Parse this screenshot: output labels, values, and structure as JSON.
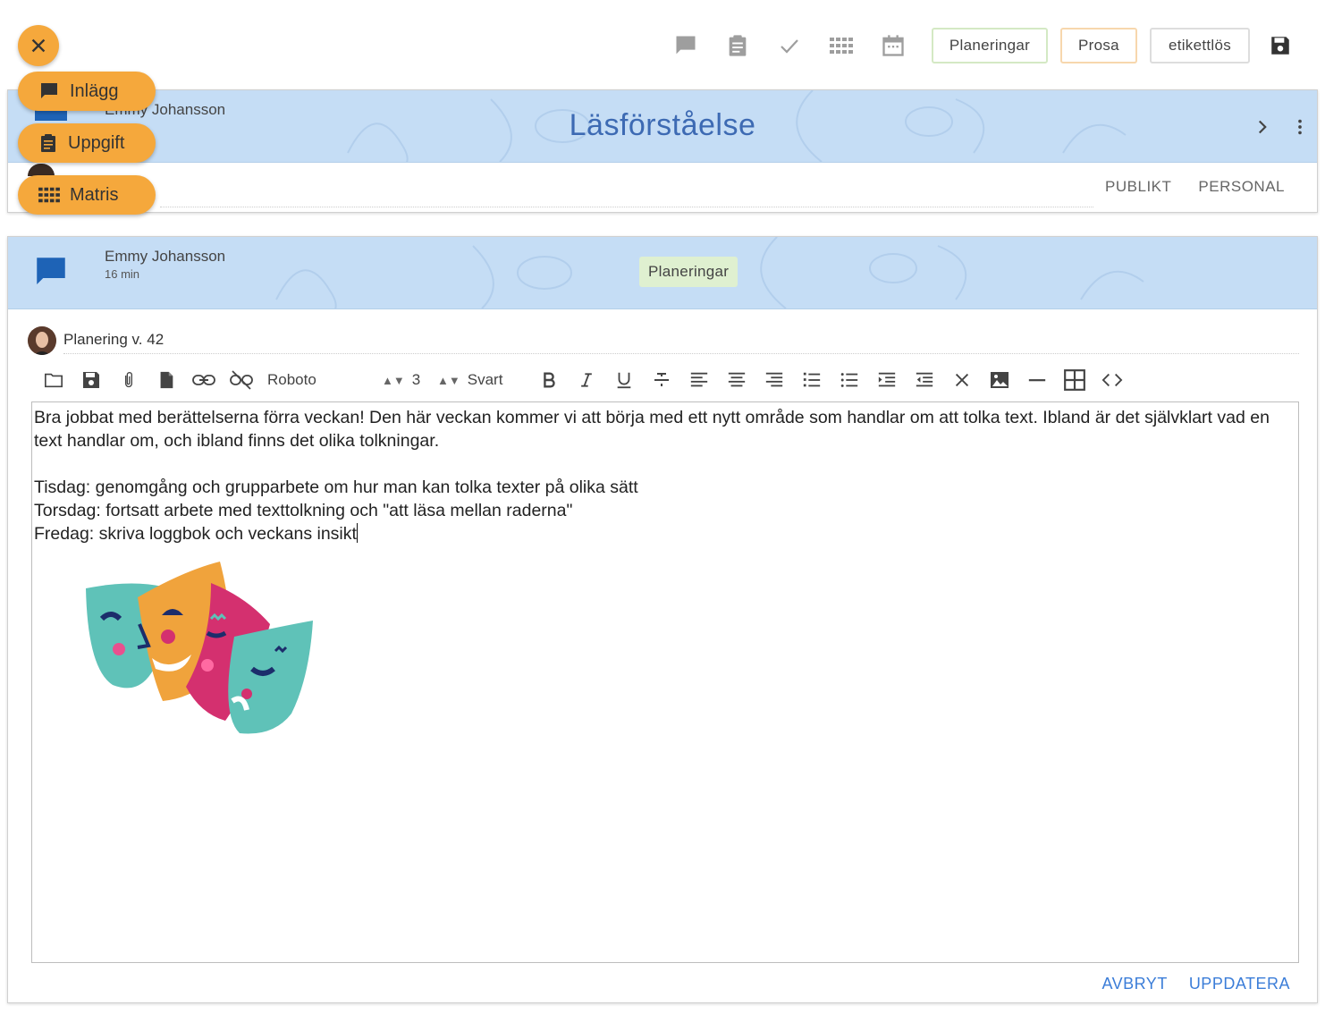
{
  "toolbar": {
    "tags": [
      {
        "label": "Planeringar",
        "border": "#d4e9c4"
      },
      {
        "label": "Prosa",
        "border": "#f7d7ad"
      },
      {
        "label": "etikettlös",
        "border": "#dddddd"
      }
    ]
  },
  "fab": {
    "items": [
      {
        "label": "Inlägg",
        "icon": "chat-icon"
      },
      {
        "label": "Uppgift",
        "icon": "clipboard-icon"
      },
      {
        "label": "Matris",
        "icon": "grid-icon"
      }
    ],
    "color": "#f5a83c"
  },
  "card1": {
    "author": "Emmy Johansson",
    "title": "Läsförståelse",
    "tabs": [
      "PUBLIKT",
      "PERSONAL"
    ],
    "banner_color": "#c5ddf5",
    "title_color": "#3d6ab3"
  },
  "post": {
    "author": "Emmy Johansson",
    "time": "16 min",
    "tag": "Planeringar",
    "title": "Planering v. 42"
  },
  "editor": {
    "font": "Roboto",
    "size": "3",
    "color": "Svart",
    "paragraphs": [
      "Bra jobbat med berättelserna förra veckan! Den här veckan kommer vi att börja med ett nytt område som handlar om att tolka text. Ibland är det självklart vad en text handlar om, och ibland finns det olika tolkningar.",
      "",
      "Tisdag: genomgång och grupparbete om hur man kan tolka texter på olika sätt",
      "Torsdag: fortsatt arbete med texttolkning och \"att läsa mellan raderna\"",
      "Fredag: skriva loggbok och veckans insikt"
    ]
  },
  "actions": {
    "cancel": "AVBRYT",
    "update": "UPPDATERA",
    "color": "#3b7dd8"
  }
}
